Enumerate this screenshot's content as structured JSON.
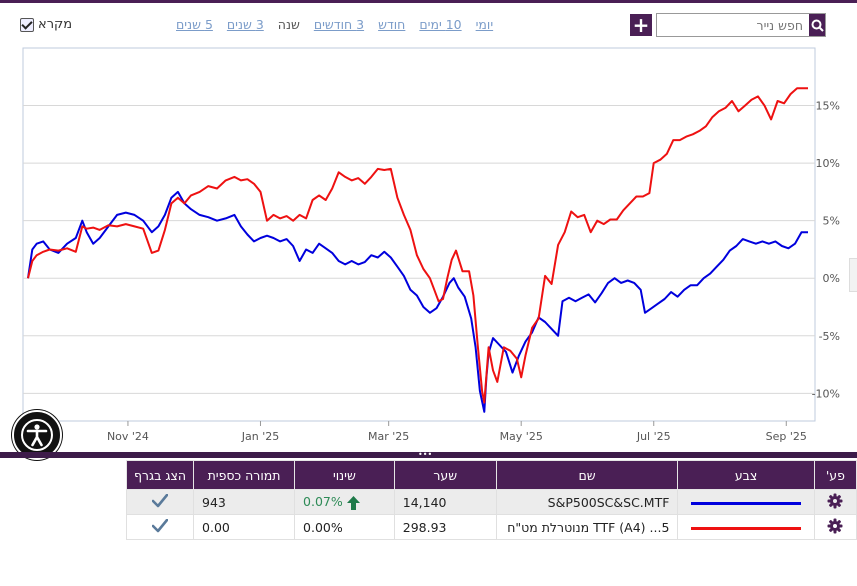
{
  "toolbar": {
    "legend_label": "מקרא",
    "legend_checked": true,
    "ranges": [
      "יומי",
      "10 ימים",
      "חודש",
      "3 חודשים",
      "שנה",
      "3 שנים",
      "5 שנים"
    ],
    "active_range": "שנה",
    "search_placeholder": "חפש נייר",
    "plus_label": "+"
  },
  "chart_data": {
    "type": "line",
    "y_axis": {
      "position": "right",
      "ticks": [
        "15%",
        "10%",
        "5%",
        "0%",
        "-5%",
        "-10%"
      ],
      "tick_values": [
        15,
        10,
        5,
        0,
        -5,
        -10
      ],
      "ylim": [
        -12.4,
        20.0
      ]
    },
    "x_axis": {
      "ticks": [
        "Nov '24",
        "Jan '25",
        "Mar '25",
        "May '25",
        "Jul '25",
        "Sep '25"
      ],
      "tick_days": [
        46,
        107,
        166,
        227,
        288,
        349
      ],
      "xlim": [
        0,
        359
      ]
    },
    "grid": true,
    "series": [
      {
        "name": "S&P500SC&SC.MTF",
        "color": "#0000dd",
        "points": [
          [
            0,
            0
          ],
          [
            2,
            2.5
          ],
          [
            4,
            3
          ],
          [
            7,
            3.2
          ],
          [
            10,
            2.5
          ],
          [
            14,
            2.2
          ],
          [
            18,
            3
          ],
          [
            22,
            3.5
          ],
          [
            25,
            5
          ],
          [
            27,
            4
          ],
          [
            30,
            3
          ],
          [
            33,
            3.5
          ],
          [
            37,
            4.5
          ],
          [
            41,
            5.5
          ],
          [
            45,
            5.7
          ],
          [
            49,
            5.5
          ],
          [
            53,
            5
          ],
          [
            57,
            4
          ],
          [
            60,
            4.5
          ],
          [
            63,
            5.5
          ],
          [
            66,
            7
          ],
          [
            69,
            7.5
          ],
          [
            72,
            6.5
          ],
          [
            75,
            6
          ],
          [
            79,
            5.5
          ],
          [
            83,
            5.3
          ],
          [
            87,
            5
          ],
          [
            91,
            5.2
          ],
          [
            95,
            5.5
          ],
          [
            98,
            4.5
          ],
          [
            101,
            3.8
          ],
          [
            104,
            3.2
          ],
          [
            107,
            3.5
          ],
          [
            110,
            3.7
          ],
          [
            113,
            3.5
          ],
          [
            116,
            3.2
          ],
          [
            119,
            3.4
          ],
          [
            122,
            2.8
          ],
          [
            125,
            1.5
          ],
          [
            128,
            2.5
          ],
          [
            131,
            2.2
          ],
          [
            134,
            3
          ],
          [
            137,
            2.6
          ],
          [
            140,
            2.2
          ],
          [
            143,
            1.5
          ],
          [
            146,
            1.2
          ],
          [
            149,
            1.5
          ],
          [
            152,
            1.2
          ],
          [
            155,
            1.4
          ],
          [
            158,
            2
          ],
          [
            161,
            1.8
          ],
          [
            164,
            2.3
          ],
          [
            167,
            1.8
          ],
          [
            170,
            1
          ],
          [
            173,
            0.2
          ],
          [
            176,
            -1
          ],
          [
            179,
            -1.5
          ],
          [
            182,
            -2.5
          ],
          [
            185,
            -3
          ],
          [
            188,
            -2.6
          ],
          [
            191,
            -1.6
          ],
          [
            194,
            -0.4
          ],
          [
            196,
            0
          ],
          [
            198,
            -0.8
          ],
          [
            201,
            -1.6
          ],
          [
            204,
            -3.5
          ],
          [
            206,
            -6
          ],
          [
            208,
            -9.8
          ],
          [
            210,
            -11.6
          ],
          [
            211,
            -8.6
          ],
          [
            212,
            -6.5
          ],
          [
            214,
            -5.2
          ],
          [
            217,
            -5.8
          ],
          [
            220,
            -6.4
          ],
          [
            223,
            -8.2
          ],
          [
            226,
            -6.7
          ],
          [
            229,
            -5.5
          ],
          [
            232,
            -4.7
          ],
          [
            235,
            -3.4
          ],
          [
            238,
            -3.8
          ],
          [
            241,
            -4.4
          ],
          [
            244,
            -5
          ],
          [
            246,
            -2
          ],
          [
            249,
            -1.7
          ],
          [
            252,
            -2
          ],
          [
            255,
            -1.7
          ],
          [
            258,
            -1.4
          ],
          [
            261,
            -2.1
          ],
          [
            264,
            -1.3
          ],
          [
            267,
            -0.4
          ],
          [
            270,
            0
          ],
          [
            273,
            -0.4
          ],
          [
            276,
            -0.2
          ],
          [
            279,
            -0.4
          ],
          [
            282,
            -1
          ],
          [
            284,
            -3
          ],
          [
            287,
            -2.6
          ],
          [
            290,
            -2.2
          ],
          [
            293,
            -1.8
          ],
          [
            296,
            -1.2
          ],
          [
            299,
            -1.6
          ],
          [
            302,
            -1
          ],
          [
            305,
            -0.6
          ],
          [
            308,
            -0.6
          ],
          [
            311,
            0
          ],
          [
            314,
            0.4
          ],
          [
            317,
            1
          ],
          [
            320,
            1.6
          ],
          [
            323,
            2.4
          ],
          [
            326,
            2.8
          ],
          [
            329,
            3.4
          ],
          [
            332,
            3.2
          ],
          [
            335,
            3
          ],
          [
            338,
            3.2
          ],
          [
            341,
            3
          ],
          [
            344,
            3.2
          ],
          [
            347,
            2.8
          ],
          [
            350,
            2.6
          ],
          [
            353,
            3
          ],
          [
            356,
            4
          ],
          [
            359,
            4
          ]
        ]
      },
      {
        "name": "5... TTF (A4) מנוטרלת מט\"ח",
        "color": "#ee1111",
        "points": [
          [
            0,
            0
          ],
          [
            2,
            1.5
          ],
          [
            4,
            2
          ],
          [
            7,
            2.3
          ],
          [
            10,
            2.5
          ],
          [
            14,
            2.4
          ],
          [
            18,
            2.6
          ],
          [
            22,
            2.3
          ],
          [
            25,
            4.5
          ],
          [
            27,
            4.3
          ],
          [
            30,
            4.4
          ],
          [
            33,
            4.2
          ],
          [
            37,
            4.6
          ],
          [
            41,
            4.5
          ],
          [
            45,
            4.7
          ],
          [
            49,
            4.5
          ],
          [
            53,
            4.3
          ],
          [
            57,
            2.2
          ],
          [
            60,
            2.4
          ],
          [
            63,
            4.2
          ],
          [
            66,
            6.5
          ],
          [
            69,
            7
          ],
          [
            72,
            6.5
          ],
          [
            75,
            7.2
          ],
          [
            79,
            7.5
          ],
          [
            83,
            8
          ],
          [
            87,
            7.8
          ],
          [
            91,
            8.5
          ],
          [
            95,
            8.8
          ],
          [
            98,
            8.5
          ],
          [
            101,
            8.6
          ],
          [
            104,
            8.2
          ],
          [
            107,
            7.5
          ],
          [
            110,
            5
          ],
          [
            113,
            5.5
          ],
          [
            116,
            5.2
          ],
          [
            119,
            5.4
          ],
          [
            122,
            5
          ],
          [
            125,
            5.5
          ],
          [
            128,
            5.2
          ],
          [
            131,
            6.8
          ],
          [
            134,
            7.2
          ],
          [
            137,
            6.8
          ],
          [
            140,
            7.8
          ],
          [
            143,
            9.2
          ],
          [
            146,
            8.8
          ],
          [
            149,
            8.5
          ],
          [
            152,
            8.7
          ],
          [
            155,
            8.2
          ],
          [
            158,
            8.8
          ],
          [
            161,
            9.5
          ],
          [
            164,
            9.4
          ],
          [
            167,
            9.5
          ],
          [
            170,
            7
          ],
          [
            173,
            5.5
          ],
          [
            176,
            4.2
          ],
          [
            179,
            2
          ],
          [
            182,
            0.8
          ],
          [
            185,
            0
          ],
          [
            187,
            -1
          ],
          [
            189,
            -2
          ],
          [
            191,
            -1.8
          ],
          [
            193,
            0
          ],
          [
            195,
            1.6
          ],
          [
            197,
            2.4
          ],
          [
            200,
            0.6
          ],
          [
            203,
            0.6
          ],
          [
            205,
            -1.5
          ],
          [
            207,
            -5.8
          ],
          [
            209,
            -9.8
          ],
          [
            210,
            -10.8
          ],
          [
            212,
            -6
          ],
          [
            214,
            -8
          ],
          [
            216,
            -9
          ],
          [
            219,
            -6
          ],
          [
            222,
            -6.3
          ],
          [
            225,
            -7
          ],
          [
            227,
            -8.6
          ],
          [
            229,
            -6.7
          ],
          [
            232,
            -4.3
          ],
          [
            235,
            -3.5
          ],
          [
            238,
            0.2
          ],
          [
            241,
            -0.5
          ],
          [
            244,
            2.9
          ],
          [
            247,
            4
          ],
          [
            250,
            5.8
          ],
          [
            253,
            5.3
          ],
          [
            256,
            5.5
          ],
          [
            259,
            4
          ],
          [
            262,
            5
          ],
          [
            265,
            4.7
          ],
          [
            268,
            5.1
          ],
          [
            271,
            5.1
          ],
          [
            274,
            5.9
          ],
          [
            277,
            6.5
          ],
          [
            280,
            7.1
          ],
          [
            283,
            7.1
          ],
          [
            286,
            7.4
          ],
          [
            288,
            10
          ],
          [
            291,
            10.3
          ],
          [
            294,
            10.8
          ],
          [
            297,
            12
          ],
          [
            300,
            12
          ],
          [
            303,
            12.3
          ],
          [
            306,
            12.5
          ],
          [
            309,
            12.8
          ],
          [
            312,
            13.2
          ],
          [
            315,
            14
          ],
          [
            318,
            14.5
          ],
          [
            321,
            14.8
          ],
          [
            324,
            15.4
          ],
          [
            327,
            14.5
          ],
          [
            330,
            15
          ],
          [
            333,
            15.5
          ],
          [
            336,
            15.8
          ],
          [
            339,
            15
          ],
          [
            342,
            13.8
          ],
          [
            345,
            15.4
          ],
          [
            348,
            15.2
          ],
          [
            351,
            16
          ],
          [
            354,
            16.5
          ],
          [
            357,
            16.5
          ],
          [
            359,
            16.5
          ]
        ]
      }
    ]
  },
  "table": {
    "headers": {
      "settings": "פע'",
      "color": "צבע",
      "name": "שם",
      "price": "שער",
      "change": "שינוי",
      "value": "תמורה כספית",
      "show": "הצג בגרף"
    },
    "rows": [
      {
        "color": "#0000dd",
        "name": "S&P500SC&SC.MTF",
        "price": "14,140",
        "change": "0.07%",
        "value": "943",
        "direction": "up",
        "show": true
      },
      {
        "color": "#ee1111",
        "name": "5... TTF (A4) מנוטרלת מט\"ח",
        "price": "298.93",
        "change": "0.00%",
        "value": "0.00",
        "direction": "none",
        "show": true
      }
    ]
  }
}
